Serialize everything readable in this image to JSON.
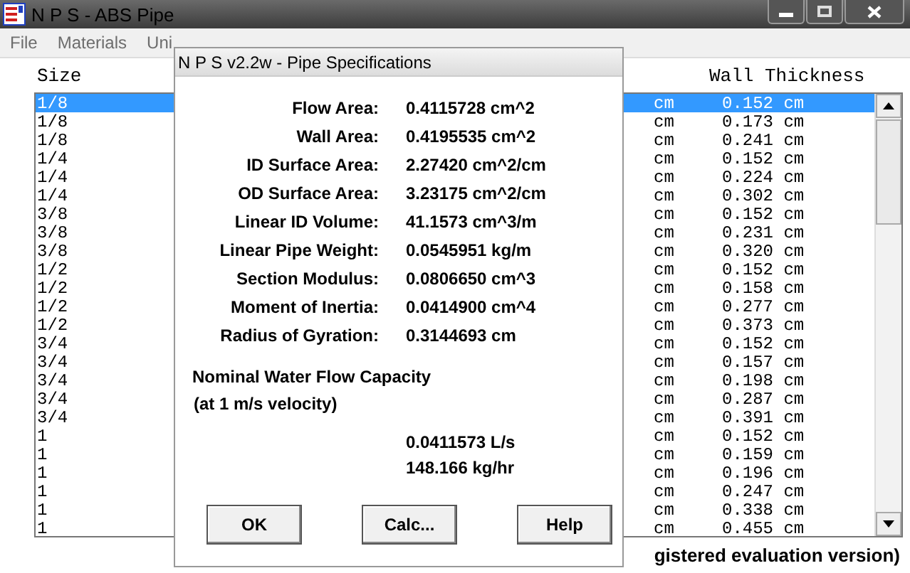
{
  "window": {
    "title": "N P S - ABS Pipe"
  },
  "menu": [
    {
      "label": "File"
    },
    {
      "label": "Materials"
    },
    {
      "label": "Uni"
    }
  ],
  "list": {
    "columns": [
      "Size",
      "Wall Thickness"
    ],
    "rows": [
      {
        "size": "1/8",
        "column_3": "cm",
        "wall_thickness": "0.152 cm",
        "selected": true
      },
      {
        "size": "1/8",
        "column_3": "cm",
        "wall_thickness": "0.173 cm",
        "selected": false
      },
      {
        "size": "1/8",
        "column_3": "cm",
        "wall_thickness": "0.241 cm",
        "selected": false
      },
      {
        "size": "1/4",
        "column_3": "cm",
        "wall_thickness": "0.152 cm",
        "selected": false
      },
      {
        "size": "1/4",
        "column_3": "cm",
        "wall_thickness": "0.224 cm",
        "selected": false
      },
      {
        "size": "1/4",
        "column_3": "cm",
        "wall_thickness": "0.302 cm",
        "selected": false
      },
      {
        "size": "3/8",
        "column_3": "cm",
        "wall_thickness": "0.152 cm",
        "selected": false
      },
      {
        "size": "3/8",
        "column_3": "cm",
        "wall_thickness": "0.231 cm",
        "selected": false
      },
      {
        "size": "3/8",
        "column_3": "cm",
        "wall_thickness": "0.320 cm",
        "selected": false
      },
      {
        "size": "1/2",
        "column_3": "cm",
        "wall_thickness": "0.152 cm",
        "selected": false
      },
      {
        "size": "1/2",
        "column_3": "cm",
        "wall_thickness": "0.158 cm",
        "selected": false
      },
      {
        "size": "1/2",
        "column_3": "cm",
        "wall_thickness": "0.277 cm",
        "selected": false
      },
      {
        "size": "1/2",
        "column_3": "cm",
        "wall_thickness": "0.373 cm",
        "selected": false
      },
      {
        "size": "3/4",
        "column_3": "cm",
        "wall_thickness": "0.152 cm",
        "selected": false
      },
      {
        "size": "3/4",
        "column_3": "cm",
        "wall_thickness": "0.157 cm",
        "selected": false
      },
      {
        "size": "3/4",
        "column_3": "cm",
        "wall_thickness": "0.198 cm",
        "selected": false
      },
      {
        "size": "3/4",
        "column_3": "cm",
        "wall_thickness": "0.287 cm",
        "selected": false
      },
      {
        "size": "3/4",
        "column_3": "cm",
        "wall_thickness": "0.391 cm",
        "selected": false
      },
      {
        "size": "1",
        "column_3": "cm",
        "wall_thickness": "0.152 cm",
        "selected": false
      },
      {
        "size": "1",
        "column_3": "cm",
        "wall_thickness": "0.159 cm",
        "selected": false
      },
      {
        "size": "1",
        "column_3": "cm",
        "wall_thickness": "0.196 cm",
        "selected": false
      },
      {
        "size": "1",
        "column_3": "cm",
        "wall_thickness": "0.247 cm",
        "selected": false
      },
      {
        "size": "1",
        "column_3": "cm",
        "wall_thickness": "0.338 cm",
        "selected": false
      },
      {
        "size": "1",
        "column_3": "cm",
        "wall_thickness": "0.455 cm",
        "selected": false
      }
    ]
  },
  "status_bar": "gistered evaluation version)",
  "dialog": {
    "title": "N P S v2.2w - Pipe Specifications",
    "properties": [
      {
        "label": "Flow Area:",
        "value": "0.4115728 cm^2"
      },
      {
        "label": "Wall Area:",
        "value": "0.4195535 cm^2"
      },
      {
        "label": "ID Surface Area:",
        "value": "2.27420 cm^2/cm"
      },
      {
        "label": "OD Surface Area:",
        "value": "3.23175 cm^2/cm"
      },
      {
        "label": "Linear ID Volume:",
        "value": "41.1573 cm^3/m"
      },
      {
        "label": "Linear Pipe Weight:",
        "value": "0.0545951 kg/m"
      },
      {
        "label": "Section Modulus:",
        "value": "0.0806650 cm^3"
      },
      {
        "label": "Moment of Inertia:",
        "value": "0.0414900 cm^4"
      },
      {
        "label": "Radius of Gyration:",
        "value": "0.3144693 cm"
      }
    ],
    "flow_heading": "Nominal Water Flow Capacity",
    "flow_note": "(at 1 m/s velocity)",
    "flow_values": [
      "0.0411573 L/s",
      "148.166 kg/hr"
    ],
    "buttons": [
      "OK",
      "Calc...",
      "Help"
    ]
  }
}
